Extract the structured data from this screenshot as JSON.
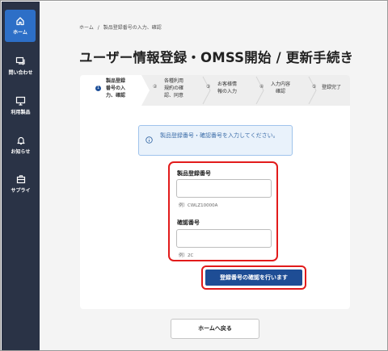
{
  "sidebar": {
    "items": [
      {
        "label": "ホーム",
        "icon": "home-icon",
        "active": true
      },
      {
        "label": "問い合わせ",
        "icon": "chat-icon",
        "active": false
      },
      {
        "label": "利用製品",
        "icon": "monitor-icon",
        "active": false
      },
      {
        "label": "お知らせ",
        "icon": "bell-icon",
        "active": false
      },
      {
        "label": "サプライ",
        "icon": "toolbox-icon",
        "active": false
      }
    ]
  },
  "breadcrumb": {
    "home": "ホーム",
    "separator": "/",
    "current": "製品登録番号の入力、確認"
  },
  "page_title": "ユーザー情報登録・OMSS開始 / 更新手続き",
  "steps": [
    {
      "number": "1",
      "label_lines": [
        "製品登録",
        "番号の入",
        "力、確認"
      ],
      "active": true
    },
    {
      "number": "②",
      "label_lines": [
        "各種利用",
        "規約の確",
        "認、同意"
      ],
      "active": false
    },
    {
      "number": "③",
      "label_lines": [
        "お客様情",
        "報の入力"
      ],
      "active": false
    },
    {
      "number": "④",
      "label_lines": [
        "入力内容",
        "確認"
      ],
      "active": false
    },
    {
      "number": "⑤",
      "label_lines": [
        "登録完了"
      ],
      "active": false
    }
  ],
  "info_message": "製品登録番号・確認番号を入力してください。",
  "form": {
    "serial": {
      "label": "製品登録番号",
      "value": "",
      "hint": "例）CWLZ10000A"
    },
    "confirm": {
      "label": "確認番号",
      "value": "",
      "hint": "例）2C"
    }
  },
  "buttons": {
    "verify": "登録番号の確認を行います",
    "back_home": "ホームへ戻る"
  },
  "colors": {
    "sidebar": "#2a3346",
    "accent": "#2d6fc7",
    "primary_button": "#1e4d95",
    "highlight": "#e21b1b",
    "info_bg": "#e9f2fb"
  }
}
